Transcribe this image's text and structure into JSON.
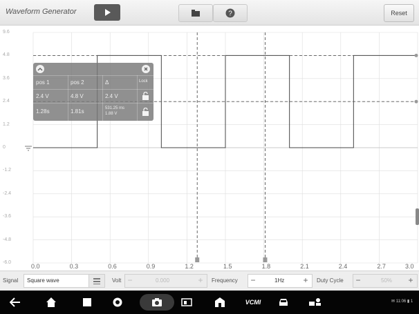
{
  "header": {
    "title": "Waveform Generator",
    "reset_label": "Reset",
    "icons": [
      "play-icon",
      "folder-icon",
      "help-icon"
    ]
  },
  "plot": {
    "y_ticks": [
      "9.6",
      "4.8",
      "3.6",
      "2.4",
      "1.2",
      "0",
      "-1.2",
      "-2.4",
      "-3.6",
      "-4.8",
      "-6.0"
    ],
    "x_ticks": [
      "0.0",
      "0.3",
      "0.6",
      "0.9",
      "1.2",
      "1.5",
      "1.8",
      "2.1",
      "2.4",
      "2.7",
      "3.0"
    ],
    "x_range": [
      0,
      3.0
    ],
    "y_range": [
      -6.0,
      6.0
    ],
    "waveform": {
      "type": "square",
      "low": 0,
      "high": 4.8,
      "period": 1.0,
      "duty": 0.5
    },
    "cursor_levels": [
      4.8,
      2.4
    ],
    "cursor_times": [
      1.28,
      1.81
    ],
    "colors": {
      "grid": "#dddddd",
      "wave": "#444444",
      "cursor": "#555555"
    }
  },
  "cursor_table": {
    "headers": [
      "pos 1",
      "pos 2",
      "Δ",
      "Lock"
    ],
    "rows": [
      [
        "2.4 V",
        "4.8 V",
        "2.4 V"
      ],
      [
        "1.28s",
        "1.81s",
        "531.25 ms\n1.88 V"
      ]
    ]
  },
  "controls": {
    "signal_label": "Signal",
    "signal_value": "Square wave",
    "volt_label": "Volt",
    "volt_value": "0.000",
    "frequency_label": "Frequency",
    "frequency_value": "1Hz",
    "duty_label": "Duty Cycle",
    "duty_value": "50%",
    "minus": "−",
    "plus": "+"
  },
  "system_bar": {
    "logo_text": "VCMI",
    "status_text": "✉ 11:06 ▮ 1",
    "icons": [
      "back-icon",
      "home-icon",
      "recents-icon",
      "chrome-icon",
      "camera-icon",
      "screen-mirror-icon",
      "shop-icon",
      "vcmi-icon",
      "car-icon",
      "diagnostics-icon"
    ]
  }
}
